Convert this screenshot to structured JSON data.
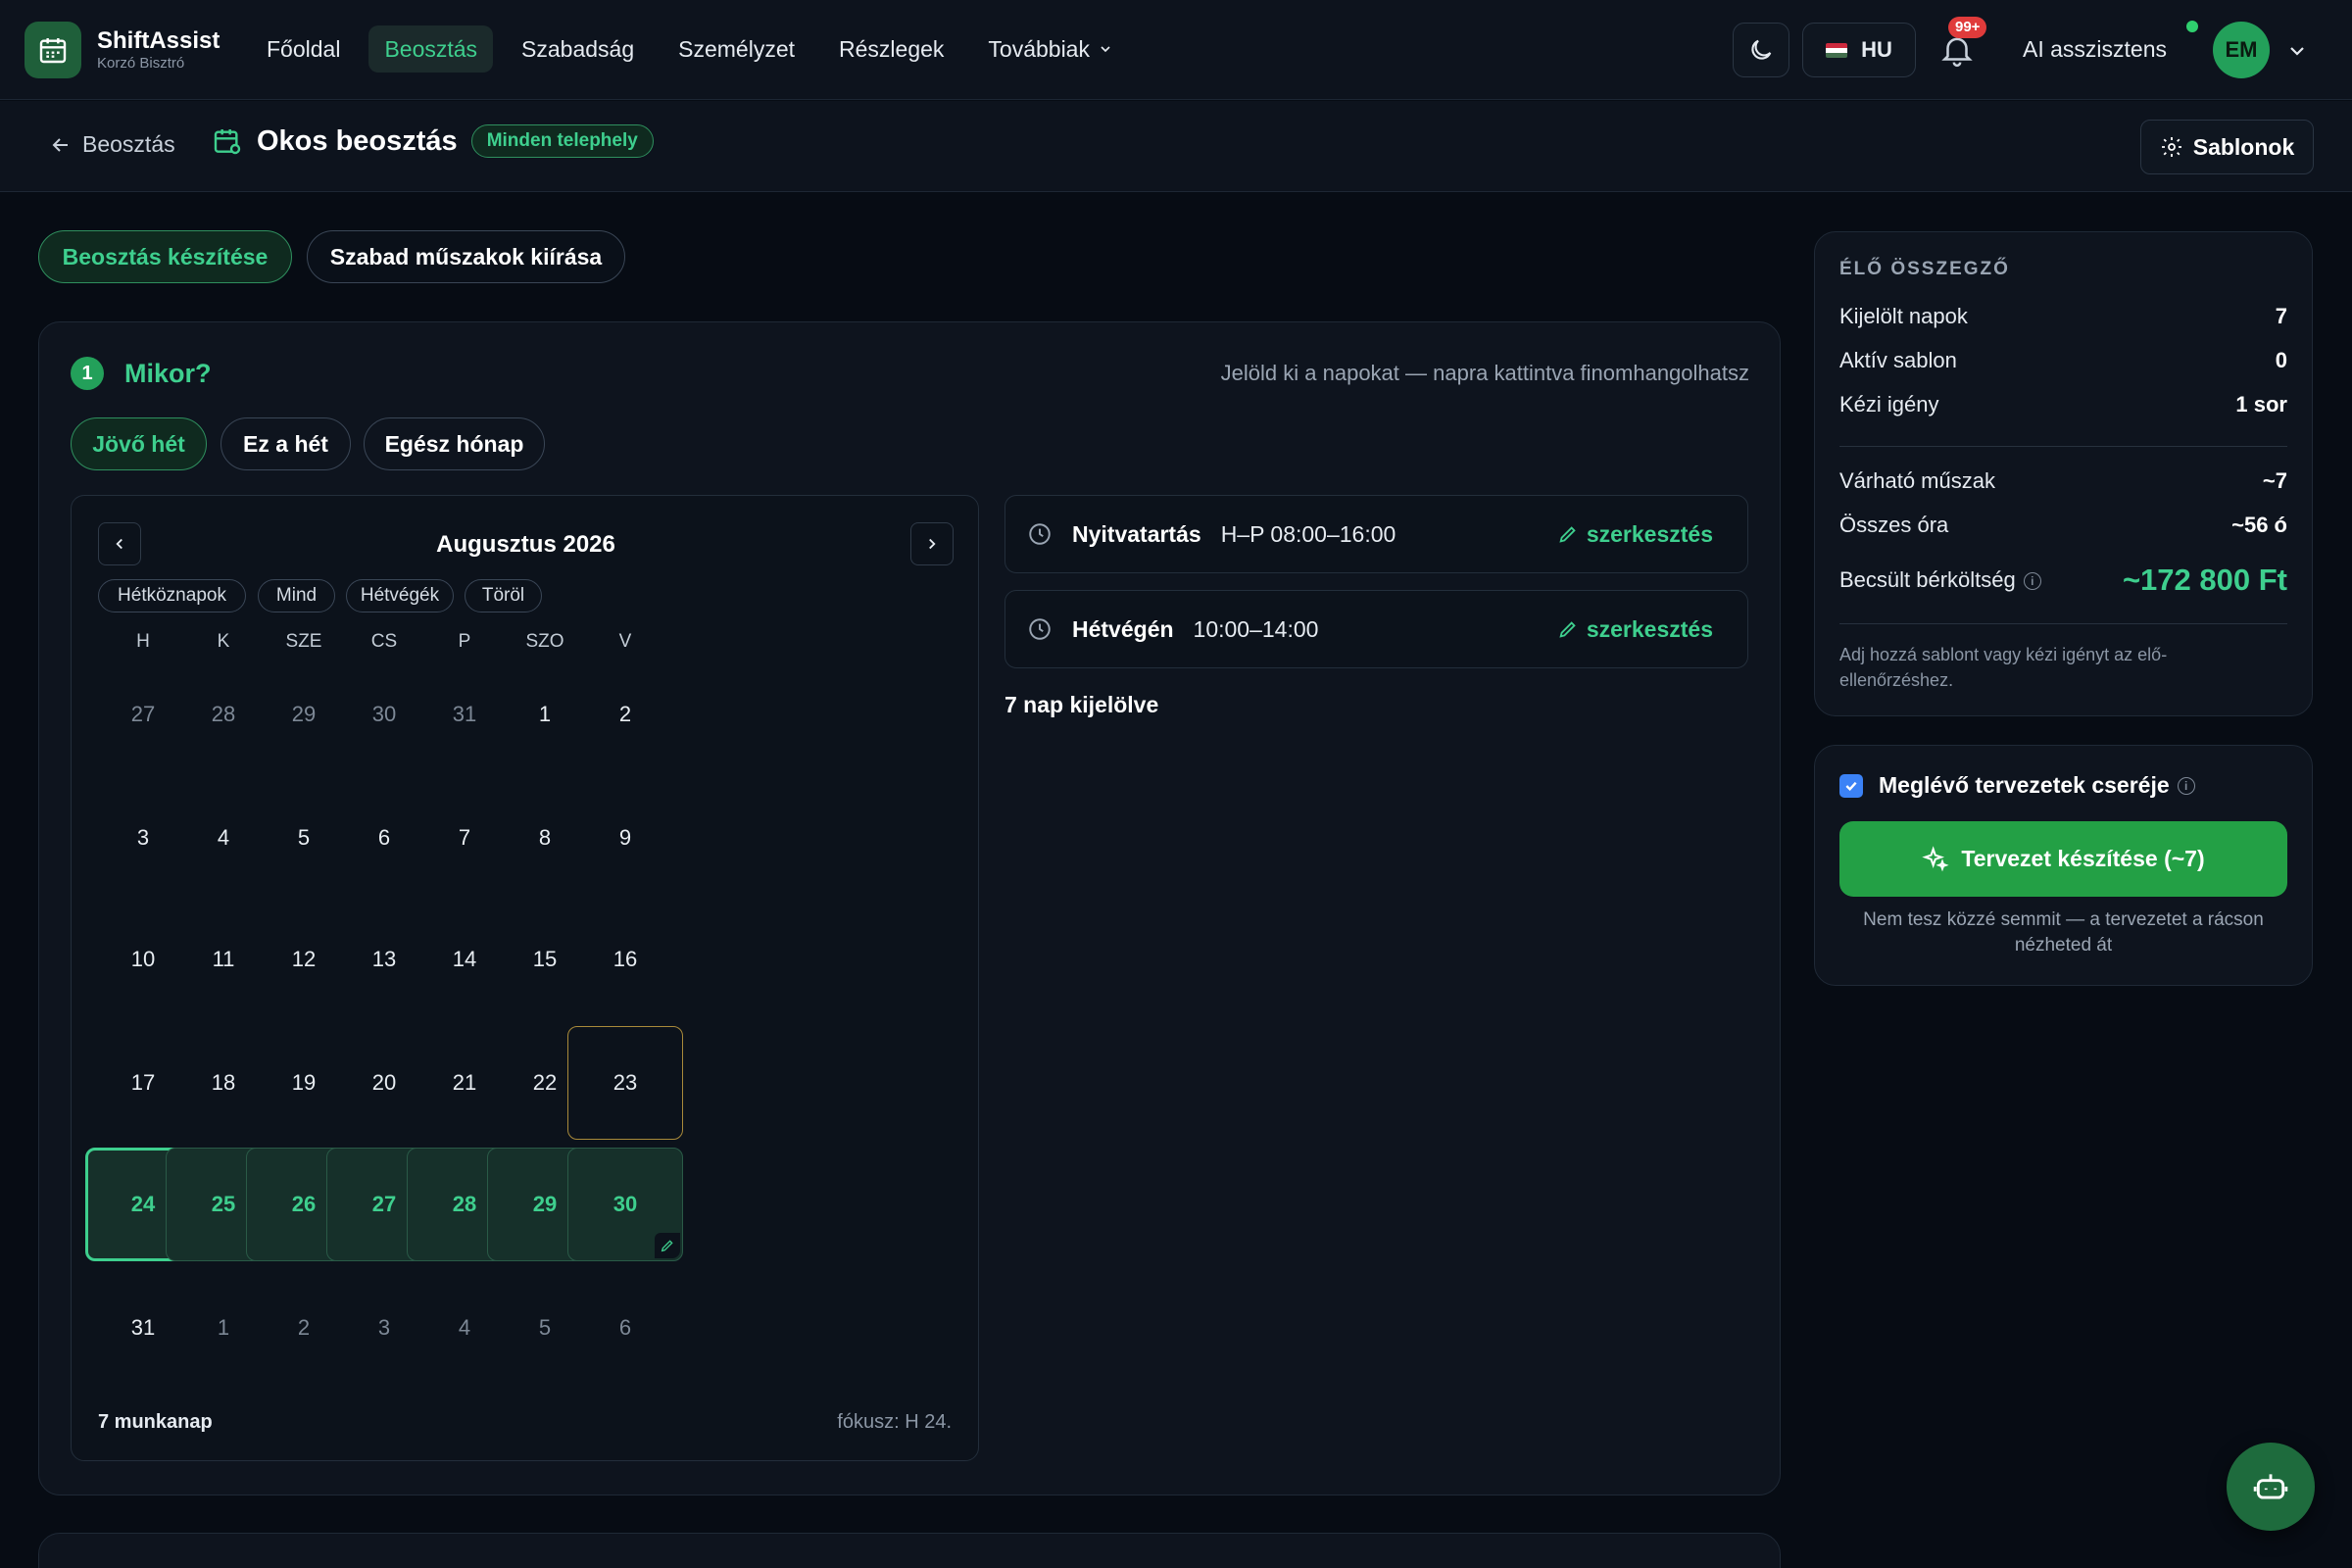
{
  "app": {
    "name": "ShiftAssist",
    "subtitle": "Korzó Bisztró"
  },
  "nav": {
    "items": [
      {
        "label": "Főoldal",
        "active": false
      },
      {
        "label": "Beosztás",
        "active": true
      },
      {
        "label": "Szabadság",
        "active": false
      },
      {
        "label": "Személyzet",
        "active": false
      },
      {
        "label": "Részlegek",
        "active": false
      },
      {
        "label": "Továbbiak",
        "active": false
      }
    ]
  },
  "header": {
    "language": "HU",
    "notifications_badge": "99+",
    "ai_label": "AI asszisztens",
    "avatar_initials": "EM"
  },
  "subheader": {
    "back_label": "Beosztás",
    "title": "Okos beosztás",
    "location_pill": "Minden telephely",
    "templates_button": "Sablonok"
  },
  "mode_tabs": [
    {
      "label": "Beosztás készítése",
      "active": true
    },
    {
      "label": "Szabad műszakok kiírása",
      "active": false
    }
  ],
  "step": {
    "number": "1",
    "title": "Mikor?",
    "hint": "Jelöld ki a napokat — napra kattintva finomhangolhatsz",
    "ranges": [
      {
        "label": "Jövő hét",
        "active": true
      },
      {
        "label": "Ez a hét",
        "active": false
      },
      {
        "label": "Egész hónap",
        "active": false
      }
    ]
  },
  "calendar": {
    "month": "Augusztus 2026",
    "chips": [
      "Hétköznapok",
      "Mind",
      "Hétvégék",
      "Töröl"
    ],
    "weekdays": [
      "H",
      "K",
      "SZE",
      "CS",
      "P",
      "SZO",
      "V"
    ],
    "weeks": [
      [
        {
          "d": "27",
          "s": "out"
        },
        {
          "d": "28",
          "s": "out"
        },
        {
          "d": "29",
          "s": "out"
        },
        {
          "d": "30",
          "s": "out"
        },
        {
          "d": "31",
          "s": "out"
        },
        {
          "d": "1",
          "s": "in"
        },
        {
          "d": "2",
          "s": "in"
        }
      ],
      [
        {
          "d": "3",
          "s": "in"
        },
        {
          "d": "4",
          "s": "in"
        },
        {
          "d": "5",
          "s": "in"
        },
        {
          "d": "6",
          "s": "in"
        },
        {
          "d": "7",
          "s": "in"
        },
        {
          "d": "8",
          "s": "in"
        },
        {
          "d": "9",
          "s": "in"
        }
      ],
      [
        {
          "d": "10",
          "s": "in"
        },
        {
          "d": "11",
          "s": "in"
        },
        {
          "d": "12",
          "s": "in"
        },
        {
          "d": "13",
          "s": "in"
        },
        {
          "d": "14",
          "s": "in"
        },
        {
          "d": "15",
          "s": "in"
        },
        {
          "d": "16",
          "s": "in"
        }
      ],
      [
        {
          "d": "17",
          "s": "in"
        },
        {
          "d": "18",
          "s": "in"
        },
        {
          "d": "19",
          "s": "in"
        },
        {
          "d": "20",
          "s": "in"
        },
        {
          "d": "21",
          "s": "in"
        },
        {
          "d": "22",
          "s": "in"
        },
        {
          "d": "23",
          "s": "today"
        }
      ],
      [
        {
          "d": "24",
          "s": "sel focus"
        },
        {
          "d": "25",
          "s": "sel"
        },
        {
          "d": "26",
          "s": "sel"
        },
        {
          "d": "27",
          "s": "sel"
        },
        {
          "d": "28",
          "s": "sel"
        },
        {
          "d": "29",
          "s": "sel"
        },
        {
          "d": "30",
          "s": "sel"
        }
      ],
      [
        {
          "d": "31",
          "s": "in"
        },
        {
          "d": "1",
          "s": "out"
        },
        {
          "d": "2",
          "s": "out"
        },
        {
          "d": "3",
          "s": "out"
        },
        {
          "d": "4",
          "s": "out"
        },
        {
          "d": "5",
          "s": "out"
        },
        {
          "d": "6",
          "s": "out"
        }
      ]
    ],
    "footer_left": "7 munkanap",
    "footer_right": "fókusz: H 24."
  },
  "hours": [
    {
      "label": "Nyitvatartás",
      "value": "H–P 08:00–16:00",
      "edit": "szerkesztés"
    },
    {
      "label": "Hétvégén",
      "value": "10:00–14:00",
      "edit": "szerkesztés"
    }
  ],
  "selected_count": "7 nap kijelölve",
  "summary": {
    "title": "ÉLŐ ÖSSZEGZŐ",
    "rows": [
      {
        "label": "Kijelölt napok",
        "value": "7"
      },
      {
        "label": "Aktív sablon",
        "value": "0"
      },
      {
        "label": "Kézi igény",
        "value": "1 sor"
      }
    ],
    "rows2": [
      {
        "label": "Várható műszak",
        "value": "~7"
      },
      {
        "label": "Összes óra",
        "value": "~56 ó"
      }
    ],
    "cost_label": "Becsült bérköltség",
    "cost_value": "~172 800 Ft",
    "note": "Adj hozzá sablont vagy kézi igényt az elő-ellenőrzéshez."
  },
  "generate": {
    "checkbox_label": "Meglévő tervezetek cseréje",
    "checked": true,
    "button": "Tervezet készítése (~7)",
    "note": "Nem tesz közzé semmit — a tervezetet a rácson nézheted át"
  },
  "colors": {
    "accent": "#3ecf8e",
    "primary_button": "#23a045",
    "background": "#070c14",
    "card": "#0e141e"
  },
  "icons": [
    "calendar-icon",
    "moon-icon",
    "bell-icon",
    "chevron-down-icon",
    "arrow-left-icon",
    "gear-icon",
    "clock-icon",
    "pencil-icon",
    "sparkles-icon",
    "robot-icon"
  ]
}
